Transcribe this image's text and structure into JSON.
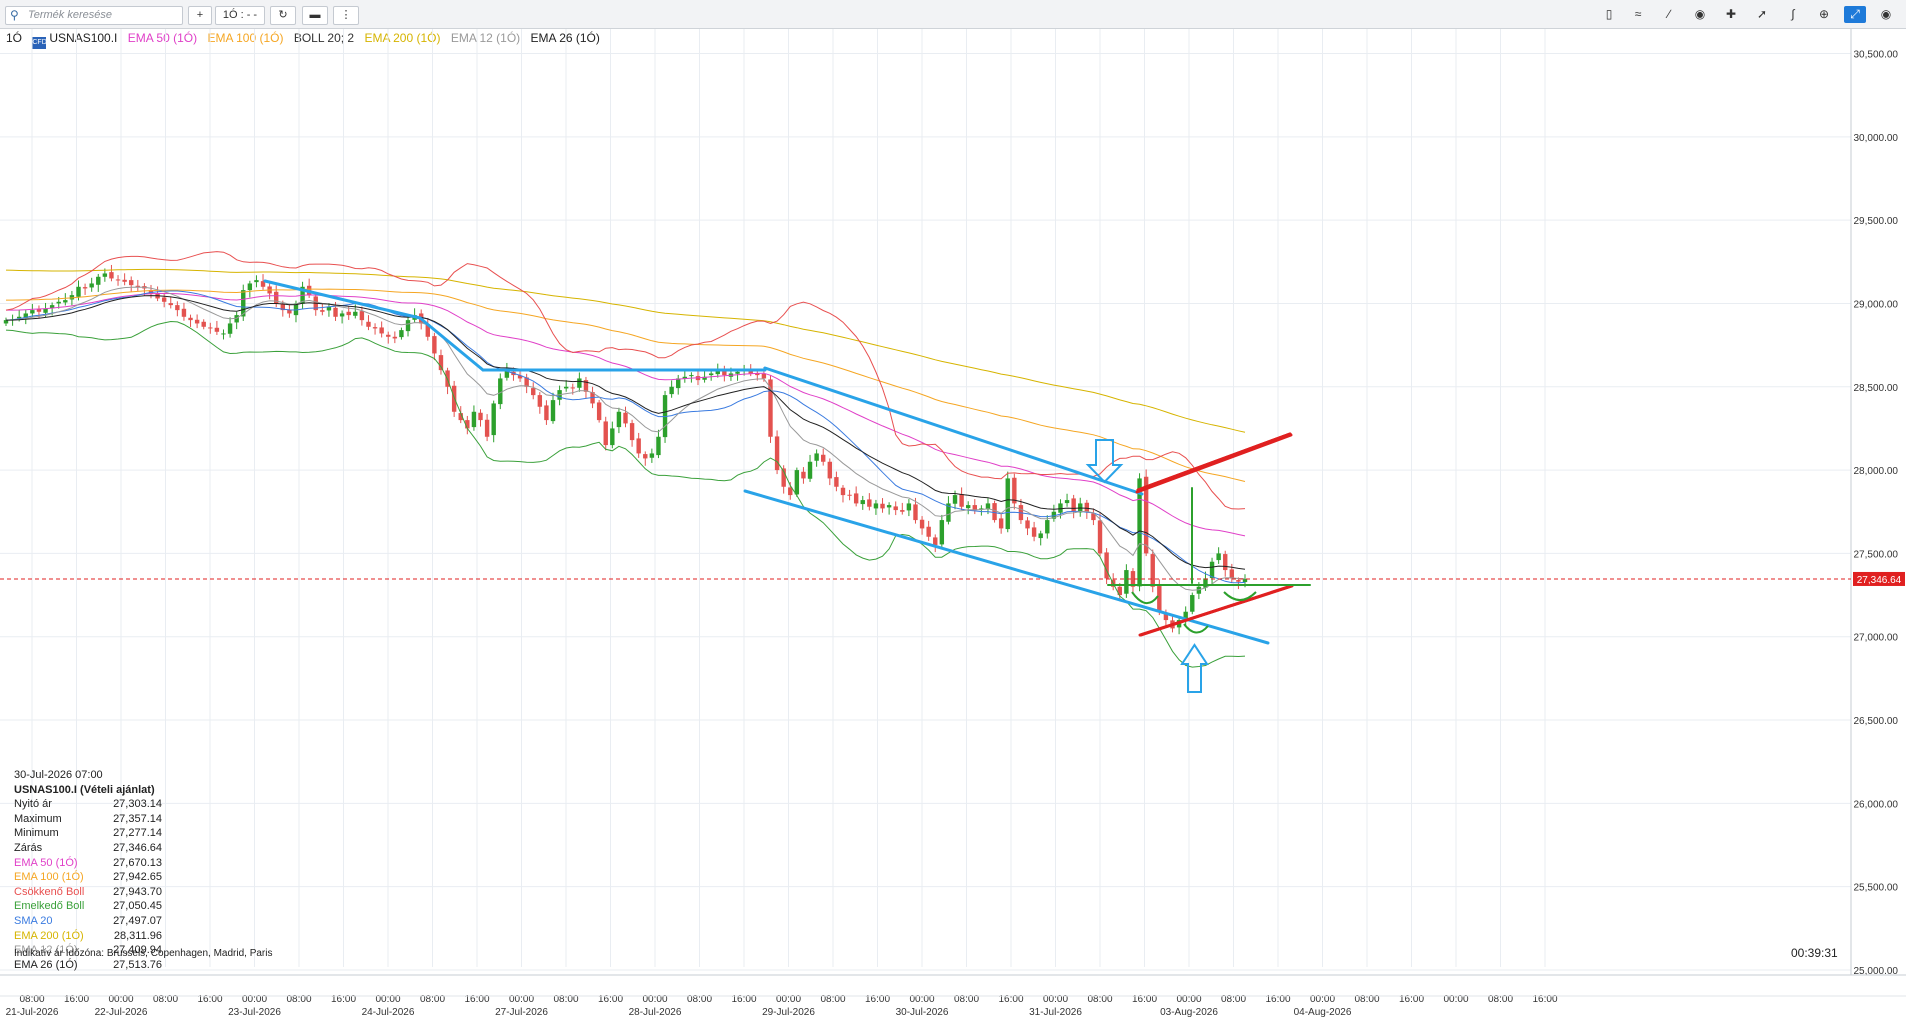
{
  "toolbar": {
    "search_placeholder": "Termék keresése",
    "add_label": "+",
    "timeframe_label": "1Ó : - -",
    "icons": [
      "refresh-icon",
      "toggle-icon",
      "more-icon",
      "candle-type-icon",
      "chart-type-icon",
      "draw-line-icon",
      "eye-icon",
      "crosshair-icon",
      "trend-icon",
      "indicator-icon",
      "zoom-icon",
      "fullscreen-icon",
      "camera-icon",
      "settings-icon"
    ]
  },
  "legend": {
    "timeframe": "1Ó",
    "badge": "CFD",
    "symbol": "USNAS100.I",
    "indicators": [
      {
        "label": "EMA 50 (1Ó)",
        "color": "#e040c8"
      },
      {
        "label": "EMA 100 (1Ó)",
        "color": "#f5a623"
      },
      {
        "label": "BOLL 20; 2",
        "color": "#333333"
      },
      {
        "label": "EMA 200 (1Ó)",
        "color": "#d6b400"
      },
      {
        "label": "EMA 12 (1Ó)",
        "color": "#999999"
      },
      {
        "label": "EMA 26 (1Ó)",
        "color": "#222222"
      }
    ]
  },
  "info_panel": {
    "datetime": "30-Jul-2026 07:00",
    "title": "USNAS100.I (Vételi ajánlat)",
    "rows": [
      {
        "label": "Nyitó ár",
        "value": "27,303.14",
        "color": "#222222"
      },
      {
        "label": "Maximum",
        "value": "27,357.14",
        "color": "#222222"
      },
      {
        "label": "Minimum",
        "value": "27,277.14",
        "color": "#222222"
      },
      {
        "label": "Zárás",
        "value": "27,346.64",
        "color": "#222222"
      },
      {
        "label": "EMA 50 (1Ó)",
        "value": "27,670.13",
        "color": "#e040c8"
      },
      {
        "label": "EMA 100 (1Ó)",
        "value": "27,942.65",
        "color": "#f5a623"
      },
      {
        "label": "Csökkenő Boll",
        "value": "27,943.70",
        "color": "#e85050"
      },
      {
        "label": "Emelkedő Boll",
        "value": "27,050.45",
        "color": "#3aa03a"
      },
      {
        "label": "SMA 20",
        "value": "27,497.07",
        "color": "#3a7be0"
      },
      {
        "label": "EMA 200 (1Ó)",
        "value": "28,311.96",
        "color": "#d6b400"
      },
      {
        "label": "EMA 12 (1Ó)",
        "value": "27,409.94",
        "color": "#999999"
      },
      {
        "label": "EMA 26 (1Ó)",
        "value": "27,513.76",
        "color": "#222222"
      }
    ],
    "footer": "Indikatív ár   Időzóna: Brussels, Copenhagen, Madrid, Paris"
  },
  "clock": "00:39:31",
  "chart_data": {
    "type": "candlestick",
    "symbol": "USNAS100.I",
    "ylim": [
      24950,
      30750
    ],
    "y_ticks": [
      25000,
      25500,
      26000,
      26500,
      27000,
      27500,
      28000,
      28500,
      29000,
      29500,
      30000,
      30500
    ],
    "y_tick_labels": [
      "25,000.00",
      "25,500.00",
      "26,000.00",
      "26,500.00",
      "27,000.00",
      "27,500.00",
      "28,000.00",
      "28,500.00",
      "29,000.00",
      "29,500.00",
      "30,000.00",
      "30,500.00"
    ],
    "current_price": 27346.64,
    "current_price_label": "27,346.64",
    "x_time_labels": [
      "08:00",
      "16:00",
      "00:00",
      "08:00",
      "16:00",
      "00:00",
      "08:00",
      "16:00",
      "00:00",
      "08:00",
      "16:00",
      "00:00",
      "08:00",
      "16:00",
      "00:00",
      "08:00",
      "16:00",
      "00:00",
      "08:00",
      "16:00",
      "00:00",
      "08:00",
      "16:00",
      "00:00",
      "08:00",
      "16:00",
      "00:00",
      "08:00",
      "16:00",
      "00:00",
      "08:00",
      "16:00",
      "00:00",
      "08:00",
      "16:00"
    ],
    "x_date_labels": [
      "21-Jul-2026",
      "22-Jul-2026",
      "23-Jul-2026",
      "24-Jul-2026",
      "27-Jul-2026",
      "28-Jul-2026",
      "29-Jul-2026",
      "30-Jul-2026",
      "31-Jul-2026",
      "03-Aug-2026",
      "04-Aug-2026"
    ],
    "close": [
      28900,
      28905,
      28920,
      28940,
      28960,
      28950,
      28970,
      28990,
      29010,
      29020,
      29050,
      29100,
      29090,
      29120,
      29160,
      29180,
      29150,
      29140,
      29130,
      29110,
      29100,
      29090,
      29060,
      29030,
      29010,
      28990,
      28960,
      28920,
      28900,
      28880,
      28860,
      28850,
      28830,
      28820,
      28880,
      28930,
      29080,
      29120,
      29140,
      29100,
      29060,
      29000,
      28960,
      28940,
      29000,
      29100,
      29050,
      28960,
      28950,
      28980,
      28920,
      28940,
      28930,
      28950,
      28900,
      28860,
      28850,
      28820,
      28800,
      28790,
      28840,
      28900,
      28930,
      28880,
      28800,
      28700,
      28600,
      28500,
      28350,
      28300,
      28250,
      28350,
      28300,
      28200,
      28400,
      28550,
      28600,
      28570,
      28550,
      28500,
      28450,
      28380,
      28300,
      28420,
      28480,
      28500,
      28490,
      28550,
      28470,
      28400,
      28300,
      28150,
      28250,
      28350,
      28280,
      28180,
      28100,
      28070,
      28100,
      28200,
      28450,
      28500,
      28550,
      28560,
      28570,
      28540,
      28560,
      28580,
      28600,
      28570,
      28580,
      28590,
      28600,
      28580,
      28570,
      28550,
      28200,
      28000,
      27900,
      27850,
      28000,
      27950,
      28050,
      28100,
      28050,
      27950,
      27900,
      27850,
      27850,
      27800,
      27820,
      27780,
      27800,
      27770,
      27790,
      27760,
      27750,
      27800,
      27700,
      27650,
      27600,
      27550,
      27700,
      27800,
      27850,
      27780,
      27790,
      27760,
      27770,
      27800,
      27700,
      27650,
      27950,
      27800,
      27700,
      27650,
      27600,
      27620,
      27700,
      27750,
      27800,
      27820,
      27750,
      27800,
      27750,
      27700,
      27500,
      27350,
      27300,
      27250,
      27400,
      27300,
      27950,
      27500,
      27300,
      27150,
      27100,
      27050,
      27100,
      27150,
      27250,
      27300,
      27350,
      27450,
      27500,
      27400,
      27350,
      27330,
      27346
    ],
    "annotations": [
      {
        "type": "trendline",
        "color": "#29a3e8"
      },
      {
        "type": "trendline",
        "color": "#e02020"
      },
      {
        "type": "arrow",
        "direction": "down",
        "color": "#29a3e8"
      },
      {
        "type": "arrow",
        "direction": "up",
        "color": "#29a3e8"
      }
    ]
  }
}
